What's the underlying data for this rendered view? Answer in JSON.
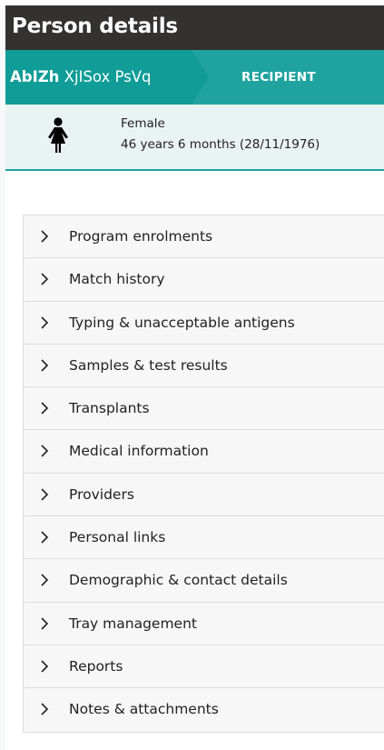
{
  "page": {
    "title": "Person details"
  },
  "person": {
    "name_bold": "AbIZh",
    "name_rest": " XjISox PsVq",
    "role": "RECIPIENT",
    "gender": "Female",
    "age": "46 years 6 months (28/11/1976)",
    "icon": "female-person-icon"
  },
  "sections": [
    {
      "label": "Program enrolments"
    },
    {
      "label": "Match history"
    },
    {
      "label": "Typing & unacceptable antigens"
    },
    {
      "label": "Samples & test results"
    },
    {
      "label": "Transplants"
    },
    {
      "label": "Medical information"
    },
    {
      "label": "Providers"
    },
    {
      "label": "Personal links"
    },
    {
      "label": "Demographic & contact details"
    },
    {
      "label": "Tray management"
    },
    {
      "label": "Reports"
    },
    {
      "label": "Notes & attachments"
    }
  ],
  "colors": {
    "header_bg": "#343131",
    "teal": "#20a39f",
    "teal_dark": "#109c97",
    "info_bg": "#eaf3f3"
  }
}
